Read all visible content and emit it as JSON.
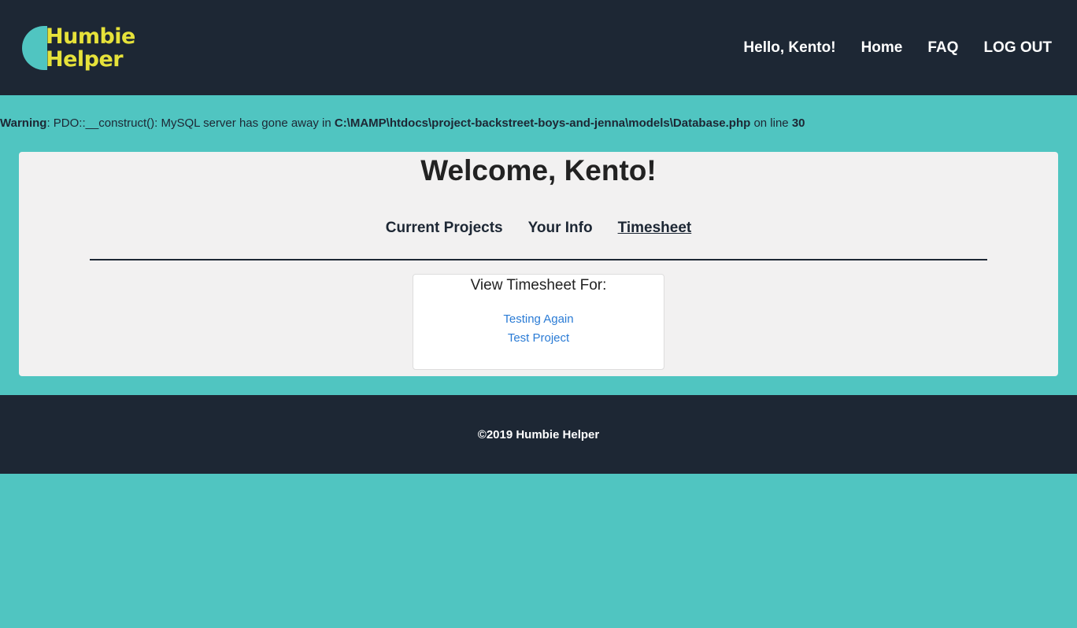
{
  "brand": {
    "line1": "Humbie",
    "line2": "Helper",
    "text_color": "#e6e23a",
    "mark_color": "#50c5c1"
  },
  "nav": {
    "greeting": "Hello, Kento!",
    "home": "Home",
    "faq": "FAQ",
    "logout": "LOG OUT"
  },
  "warning": {
    "label": "Warning",
    "message": ": PDO::__construct(): MySQL server has gone away in ",
    "path": "C:\\MAMP\\htdocs\\project-backstreet-boys-and-jenna\\models\\Database.php",
    "line_text": " on line ",
    "line_number": "30"
  },
  "main": {
    "welcome": "Welcome, Kento!",
    "tabs": [
      {
        "label": "Current Projects",
        "active": false
      },
      {
        "label": "Your Info",
        "active": false
      },
      {
        "label": "Timesheet",
        "active": true
      }
    ],
    "timesheet": {
      "title": "View Timesheet For:",
      "projects": [
        "Testing Again",
        "Test Project"
      ]
    }
  },
  "footer": {
    "copyright": "©2019 Humbie Helper"
  },
  "colors": {
    "background": "#50c5c1",
    "header": "#1d2734",
    "card": "#f2f1f1",
    "link": "#2a7bd5"
  }
}
